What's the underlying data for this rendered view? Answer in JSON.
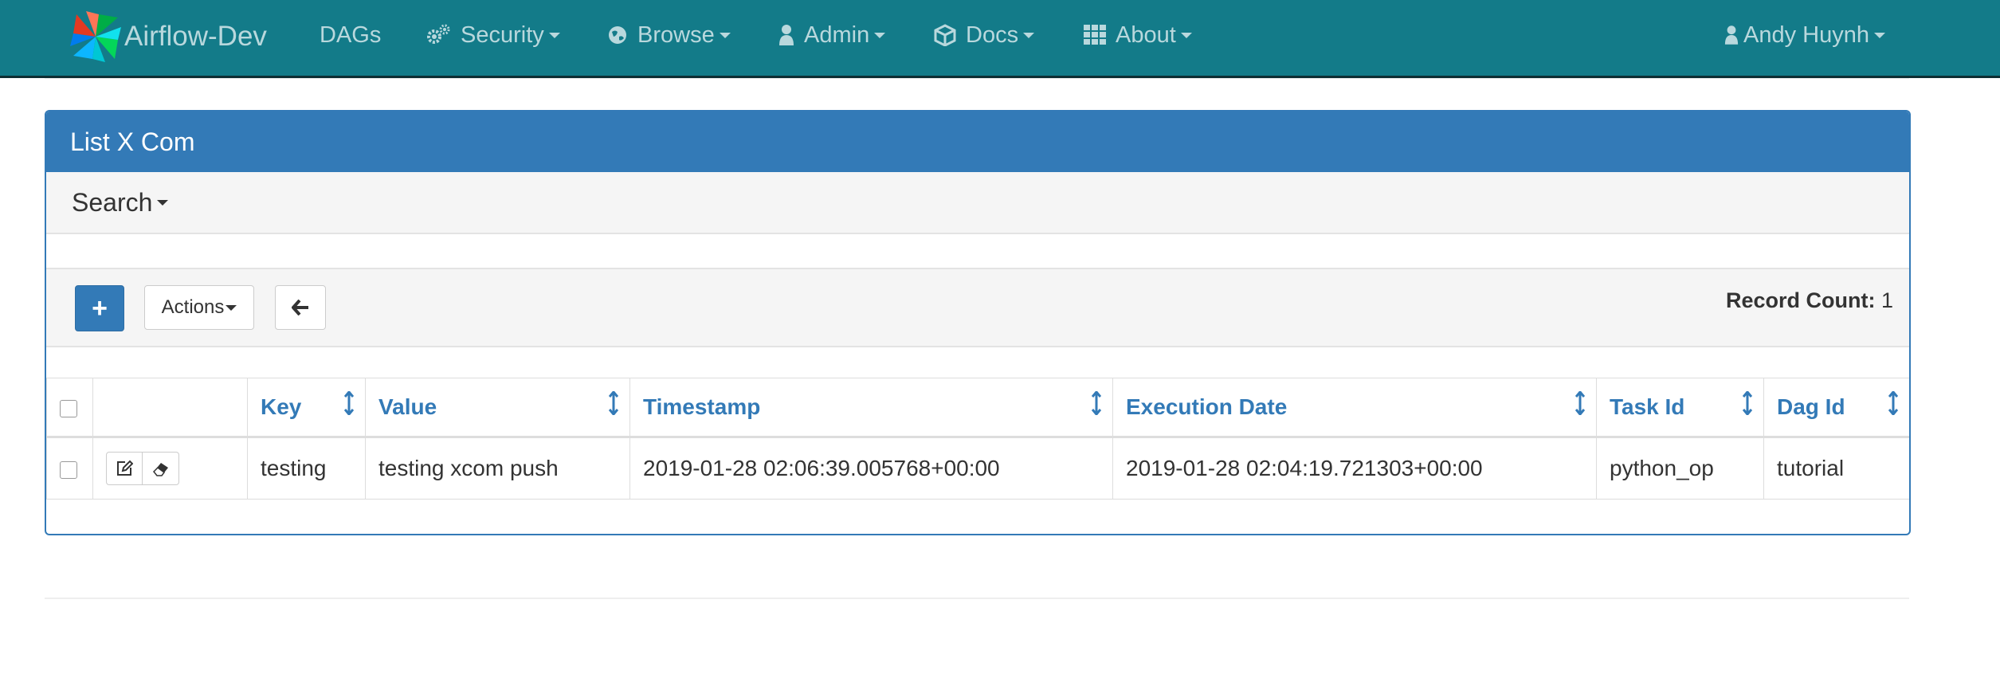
{
  "navbar": {
    "brand": "Airflow-Dev",
    "items": [
      {
        "label": "DAGs",
        "icon": ""
      },
      {
        "label": "Security",
        "icon": "gears-icon"
      },
      {
        "label": "Browse",
        "icon": "globe-icon"
      },
      {
        "label": "Admin",
        "icon": "user-icon"
      },
      {
        "label": "Docs",
        "icon": "cube-icon"
      },
      {
        "label": "About",
        "icon": "grid-icon"
      }
    ],
    "user": "Andy Huynh"
  },
  "panel": {
    "title": "List X Com",
    "search_label": "Search",
    "add_label": "+",
    "actions_label": "Actions",
    "record_count_label": "Record Count:",
    "record_count": "1"
  },
  "table": {
    "columns": [
      "Key",
      "Value",
      "Timestamp",
      "Execution Date",
      "Task Id",
      "Dag Id"
    ],
    "rows": [
      {
        "key": "testing",
        "value": "testing xcom push",
        "timestamp": "2019-01-28 02:06:39.005768+00:00",
        "execution_date": "2019-01-28 02:04:19.721303+00:00",
        "task_id": "python_op",
        "dag_id": "tutorial"
      }
    ]
  },
  "colors": {
    "navbar": "#137b89",
    "primary": "#337ab7",
    "nav_text": "#b9d8dd"
  }
}
